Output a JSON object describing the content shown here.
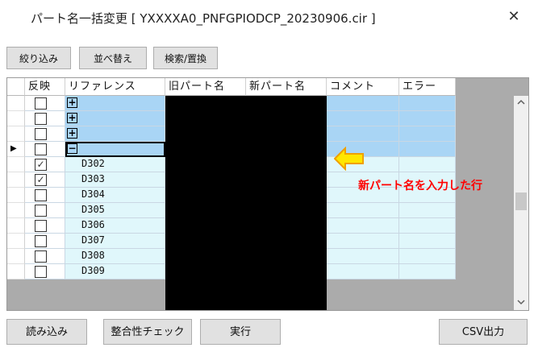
{
  "window": {
    "title": "パート名一括変更 [ YXXXXA0_PNFGPIODCP_20230906.cir ]",
    "close_glyph": "✕"
  },
  "toolbar": {
    "filter_label": "絞り込み",
    "sort_label": "並べ替え",
    "search_replace_label": "検索/置換"
  },
  "grid": {
    "columns": [
      "反映",
      "リファレンス",
      "旧パート名",
      "新パート名",
      "コメント",
      "エラー"
    ],
    "rows": [
      {
        "group": true,
        "expander": "+",
        "checked": false,
        "ref": ""
      },
      {
        "group": true,
        "expander": "+",
        "checked": false,
        "ref": ""
      },
      {
        "group": true,
        "expander": "+",
        "checked": false,
        "ref": ""
      },
      {
        "group": true,
        "expander": "−",
        "checked": false,
        "ref": "",
        "current": true
      },
      {
        "group": false,
        "checked": true,
        "ref": "D302"
      },
      {
        "group": false,
        "checked": true,
        "ref": "D303"
      },
      {
        "group": false,
        "checked": false,
        "ref": "D304"
      },
      {
        "group": false,
        "checked": false,
        "ref": "D305"
      },
      {
        "group": false,
        "checked": false,
        "ref": "D306"
      },
      {
        "group": false,
        "checked": false,
        "ref": "D307"
      },
      {
        "group": false,
        "checked": false,
        "ref": "D308"
      },
      {
        "group": false,
        "checked": false,
        "ref": "D309"
      }
    ],
    "current_row_marker": "▶",
    "colors": {
      "group_row": "#a9d5f5",
      "child_row": "#e0f7fb",
      "redacted": "#000000"
    }
  },
  "annotation": {
    "text": "新パート名を入力した行",
    "color": "#ff0000",
    "arrow_color": "#ffe600"
  },
  "footer": {
    "load_label": "読み込み",
    "consistency_label": "整合性チェック",
    "run_label": "実行",
    "csv_label": "CSV出力"
  }
}
